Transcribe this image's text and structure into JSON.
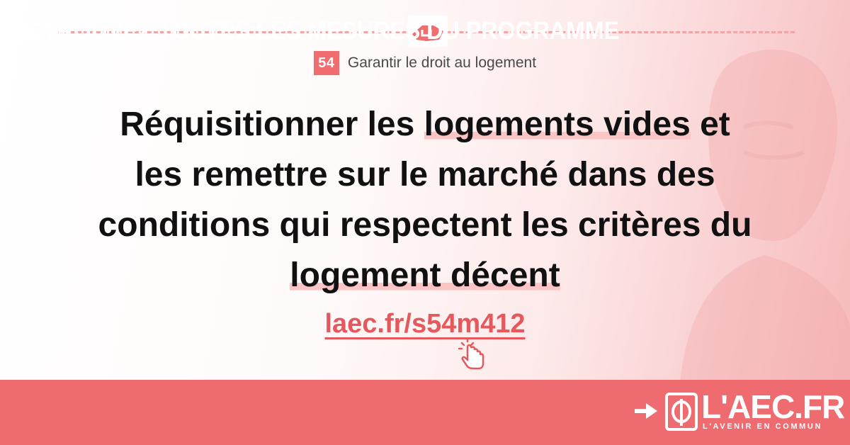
{
  "measure": {
    "number": "54",
    "title": "Garantir le droit au logement"
  },
  "headline": {
    "line1_a": "Réquisitionner les ",
    "line1_hl": "logements vides",
    "line1_b": " et",
    "line2": "les remettre sur le marché dans des",
    "line3": "conditions qui respectent les critères du",
    "line4_hl": "logement décent"
  },
  "link": {
    "text": "laec.fr/s54m412"
  },
  "banner": {
    "text": "RETROUVEZ TOUTES LES MESURES DU PROGRAMME",
    "brand_name": "L'AEC.FR",
    "brand_tagline": "L'AVENIR EN COMMUN"
  },
  "icons": {
    "emblem": "hand-shake-icon",
    "cursor": "pointing-hand-cursor-icon",
    "arrow": "right-arrow-icon",
    "brand": "phi-logo-icon"
  },
  "colors": {
    "accent": "#ee6b6f",
    "accent_dark": "#e5595c",
    "highlight": "#fbc4c5",
    "text": "#111111"
  }
}
